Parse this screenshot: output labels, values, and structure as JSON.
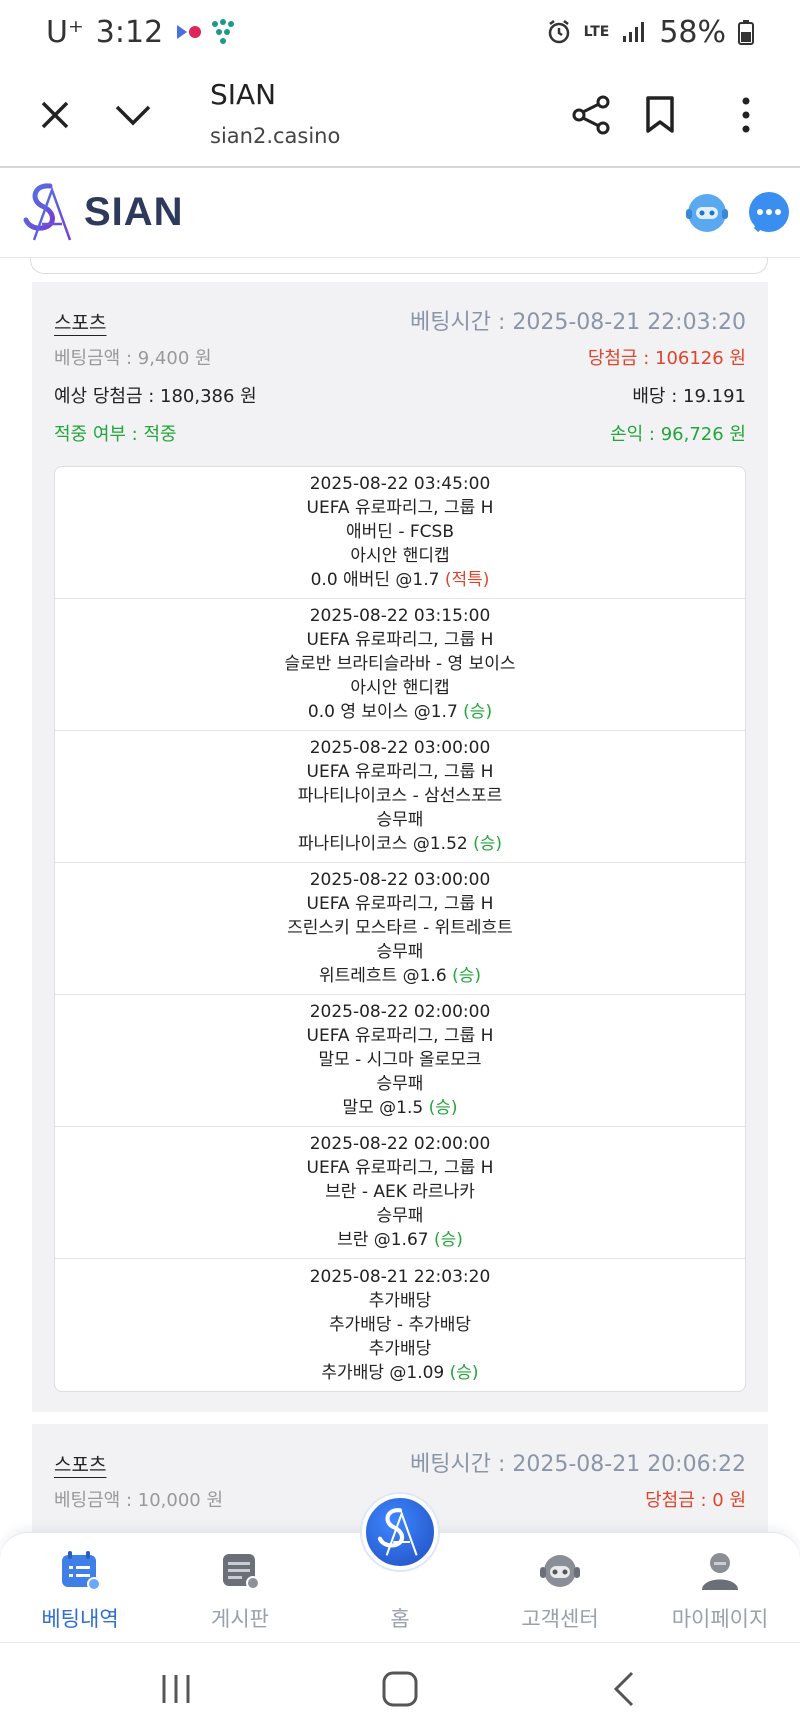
{
  "status_bar": {
    "carrier": "U⁺",
    "time": "3:12",
    "network": "LTE",
    "battery": "58%"
  },
  "browser": {
    "title": "SIAN",
    "url": "sian2.casino"
  },
  "site": {
    "logo_text": "SIAN"
  },
  "bets": [
    {
      "category": "스포츠",
      "bet_time": "베팅시간 : 2025-08-21 22:03:20",
      "bet_amount": "베팅금액 : 9,400 원",
      "win_amount": "당첨금 : 106126 원",
      "expected_win": "예상 당첨금 : 180,386 원",
      "odds": "배당 : 19.191",
      "hit_status": "적중 여부 : 적중",
      "profit": "손익 : 96,726 원",
      "picks": [
        {
          "datetime": "2025-08-22 03:45:00",
          "league": "UEFA 유로파리그, 그룹 H",
          "match": "애버딘 - FCSB",
          "market": "아시안 핸디캡",
          "selection": "0.0 애버딘 @1.7",
          "result": "(적특)",
          "result_color": "#e0452c"
        },
        {
          "datetime": "2025-08-22 03:15:00",
          "league": "UEFA 유로파리그, 그룹 H",
          "match": "슬로반 브라티슬라바 - 영 보이스",
          "market": "아시안 핸디캡",
          "selection": "0.0 영 보이스 @1.7",
          "result": "(승)",
          "result_color": "#22a53a"
        },
        {
          "datetime": "2025-08-22 03:00:00",
          "league": "UEFA 유로파리그, 그룹 H",
          "match": "파나티나이코스 - 삼선스포르",
          "market": "승무패",
          "selection": "파나티나이코스 @1.52",
          "result": "(승)",
          "result_color": "#22a53a"
        },
        {
          "datetime": "2025-08-22 03:00:00",
          "league": "UEFA 유로파리그, 그룹 H",
          "match": "즈린스키 모스타르 - 위트레흐트",
          "market": "승무패",
          "selection": "위트레흐트 @1.6",
          "result": "(승)",
          "result_color": "#22a53a"
        },
        {
          "datetime": "2025-08-22 02:00:00",
          "league": "UEFA 유로파리그, 그룹 H",
          "match": "말모 - 시그마 올로모크",
          "market": "승무패",
          "selection": "말모 @1.5",
          "result": "(승)",
          "result_color": "#22a53a"
        },
        {
          "datetime": "2025-08-22 02:00:00",
          "league": "UEFA 유로파리그, 그룹 H",
          "match": "브란 - AEK 라르나카",
          "market": "승무패",
          "selection": "브란 @1.67",
          "result": "(승)",
          "result_color": "#22a53a"
        },
        {
          "datetime": "2025-08-21 22:03:20",
          "league": "추가배당",
          "match": "추가배당 - 추가배당",
          "market": "추가배당",
          "selection": "추가배당 @1.09",
          "result": "(승)",
          "result_color": "#22a53a"
        }
      ]
    },
    {
      "category": "스포츠",
      "bet_time": "베팅시간 : 2025-08-21 20:06:22",
      "bet_amount": "베팅금액 : 10,000 원",
      "win_amount": "당첨금 : 0 원"
    }
  ],
  "bottom_nav": {
    "items": [
      {
        "label": "베팅내역",
        "icon": "calendar-list-icon",
        "active": true
      },
      {
        "label": "게시판",
        "icon": "board-icon",
        "active": false
      },
      {
        "label": "홈",
        "icon": "home-logo-icon",
        "active": false
      },
      {
        "label": "고객센터",
        "icon": "headset-icon",
        "active": false
      },
      {
        "label": "마이페이지",
        "icon": "user-icon",
        "active": false
      }
    ]
  },
  "colors": {
    "accent": "#2f6fd4",
    "win_red": "#e0452c",
    "win_green": "#22a53a",
    "muted": "#999999",
    "card_bg": "#f2f2f4"
  }
}
